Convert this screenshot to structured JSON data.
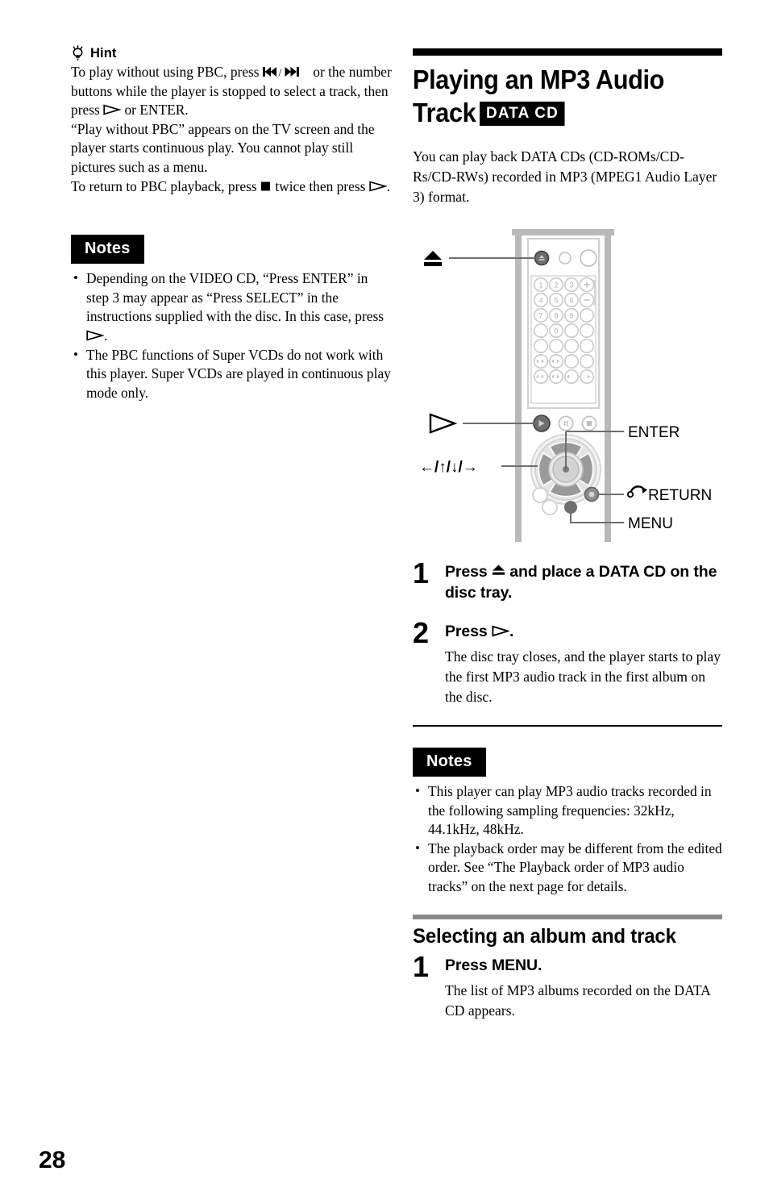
{
  "page": {
    "number": "28"
  },
  "left_column": {
    "hint": {
      "icon": "lightbulb-icon",
      "label": "Hint",
      "paragraphs": [
        "To play without using PBC, press ◀◀/▶▶ or the number buttons while the player is stopped to select a track, then press ▷ or ENTER.",
        "“Play without PBC” appears on the TV screen and the player starts continuous play. You cannot play still pictures such as a menu.",
        "To return to PBC playback, press ■ twice then press ▷."
      ],
      "line1_a": "To play without using PBC, press ",
      "line1_b": " or the number buttons while the player is stopped to select a track, then press ",
      "line1_c": " or ENTER.",
      "line2": "“Play without PBC” appears on the TV screen and the player starts continuous play. You cannot play still pictures such as a menu.",
      "line3_a": "To return to PBC playback, press ",
      "line3_b": " twice then press ",
      "line3_c": "."
    },
    "notes": {
      "title": "Notes",
      "items": [
        {
          "text_a": "Depending on the VIDEO CD, “Press ENTER” in step 3 may appear as “Press SELECT” in the instructions supplied with the disc. In this case, press ",
          "text_b": "."
        },
        {
          "text_a": "The PBC functions of Super VCDs do not work with this player. Super VCDs are played in continuous play mode only.",
          "text_b": ""
        }
      ]
    }
  },
  "right_column": {
    "heading": {
      "title": "Playing an MP3 Audio Track",
      "title_line1": "Playing an MP3 Audio",
      "title_line2": "Track",
      "badge": "DATA CD"
    },
    "intro": "You can play back DATA CDs (CD-ROMs/CD-Rs/CD-RWs) recorded in MP3 (MPEG1 Audio Layer 3) format.",
    "figure": {
      "labels": {
        "eject": "eject-symbol",
        "play": "play-symbol",
        "arrows": "←/↑/↓/→",
        "enter": "ENTER",
        "return": "RETURN",
        "menu": "MENU"
      },
      "keypad_rows": [
        [
          "1",
          "2",
          "3",
          "+"
        ],
        [
          "4",
          "5",
          "6",
          "−"
        ],
        [
          "7",
          "8",
          "9",
          ""
        ],
        [
          "",
          "0",
          "",
          ""
        ],
        [
          "",
          "",
          "",
          ""
        ],
        [
          "",
          "",
          "",
          ""
        ],
        [
          "",
          "",
          "",
          ""
        ]
      ]
    },
    "steps": [
      {
        "num": "1",
        "title_a": "Press ",
        "title_b": " and place a DATA CD on the disc tray.",
        "desc": ""
      },
      {
        "num": "2",
        "title_a": "Press ",
        "title_b": ".",
        "desc": "The disc tray closes, and the player starts to play the first MP3 audio track in the first album on the disc."
      }
    ],
    "notes": {
      "title": "Notes",
      "items": [
        "This player can play MP3 audio tracks recorded in the following sampling frequencies: 32kHz, 44.1kHz, 48kHz.",
        "The playback order may be different from the edited order. See “The Playback order of MP3 audio tracks” on the next page for details."
      ]
    },
    "subsection": {
      "title": "Selecting an album and track",
      "step": {
        "num": "1",
        "title": "Press MENU.",
        "desc": "The list of MP3 albums recorded on the DATA CD appears."
      }
    }
  },
  "colors": {
    "ink": "#000000",
    "gray_rule": "#8a8a8a",
    "remote_body": "#b4b4b4",
    "remote_button": "#c8c8c8"
  }
}
